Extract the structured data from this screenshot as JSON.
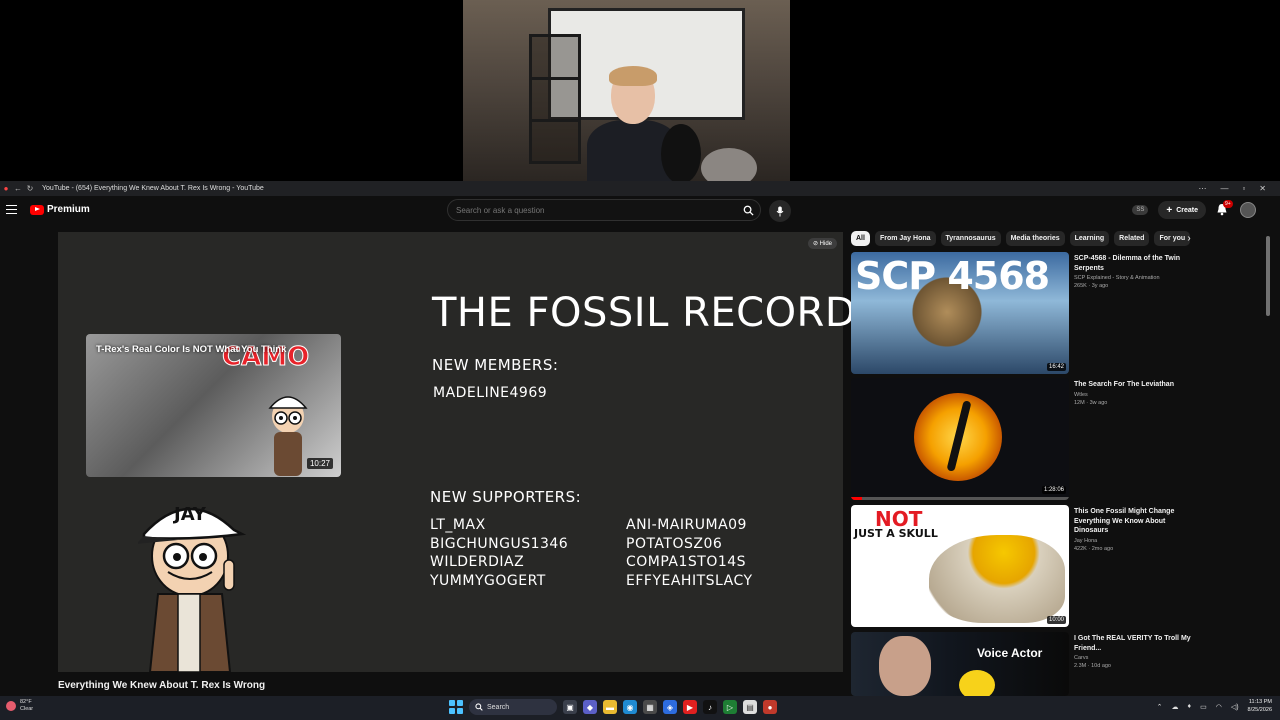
{
  "browser": {
    "tab_title": "YouTube - (654) Everything We Knew About T. Rex Is Wrong - YouTube"
  },
  "header": {
    "brand": "Premium",
    "search_placeholder": "Search or ask a question",
    "account_badge": "SS",
    "create_label": "Create",
    "notification_count": "9+"
  },
  "player": {
    "hide_label": "Hide",
    "endcard": {
      "title": "T-Rex's Real Color Is NOT What You Think",
      "overlay_word": "CAMO",
      "duration": "10:27"
    },
    "fossil_title": "THE FOSSIL RECORD",
    "new_members_heading": "NEW MEMBERS:",
    "new_members": [
      "MADELINE4969"
    ],
    "new_supporters_heading": "NEW SUPPORTERS:",
    "supporters_left": [
      "LT_MAX",
      "BIGCHUNGUS1346",
      "WILDERDIAZ",
      "YUMMYGOGERT"
    ],
    "supporters_right": [
      "ANI-MAIRUMA09",
      "POTATOSZ06",
      "COMPA1STO14S",
      "EFFYEAHITSLACY"
    ],
    "character_cap_text": "JAY"
  },
  "video": {
    "title": "Everything We Knew About T. Rex Is Wrong"
  },
  "chips": [
    "All",
    "From Jay Hona",
    "Tyrannosaurus",
    "Media theories",
    "Learning",
    "Related",
    "For you"
  ],
  "recommendations": [
    {
      "title": "SCP-4568 - Dilemma of the Twin Serpents",
      "channel": "SCP Explained - Story & Animation",
      "stats": "265K · 3y ago",
      "duration": "16:42",
      "thumb_text": "SCP 4568"
    },
    {
      "title": "The Search For The Leviathan",
      "channel": "Wtles",
      "stats": "12M · 3w ago",
      "duration": "1:28:06",
      "watched_fraction": 0.05
    },
    {
      "title": "This One Fossil Might Change Everything We Know About Dinosaurs",
      "channel": "Jay Hona",
      "stats": "422K · 2mo ago",
      "duration": "10:00",
      "thumb_text_1": "NOT",
      "thumb_text_2": "JUST A SKULL"
    },
    {
      "title": "I Got The REAL VERITY To Troll My Friend...",
      "channel": "Carvs",
      "stats": "2.3M · 10d ago",
      "thumb_text": "Voice Actor"
    }
  ],
  "taskbar": {
    "weather_temp": "82°F",
    "weather_desc": "Clear",
    "search_label": "Search",
    "time": "11:13 PM",
    "date": "8/25/2026"
  },
  "colors": {
    "youtube_red": "#ff0000",
    "page_bg": "#0f0f0f",
    "player_bg": "#282826"
  }
}
